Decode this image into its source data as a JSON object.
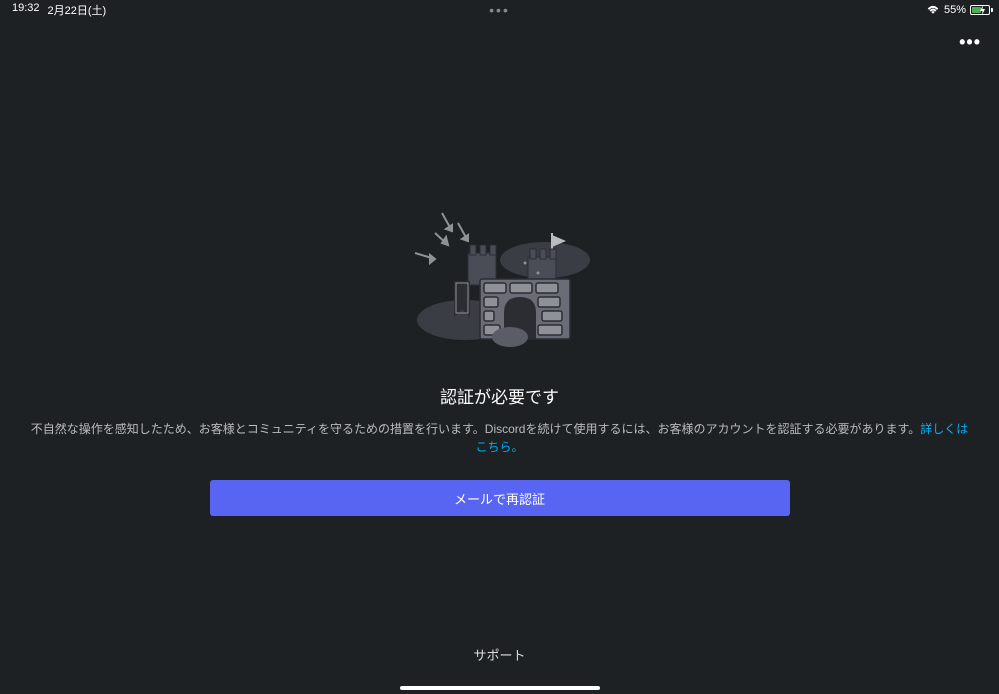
{
  "status_bar": {
    "time": "19:32",
    "date": "2月22日(土)",
    "center_dots": "•••",
    "battery_percent": "55%"
  },
  "app_bar": {
    "more_dots": "•••"
  },
  "main": {
    "title": "認証が必要です",
    "description_pre": "不自然な操作を感知したため、お客様とコミュニティを守るための措置を行います。Discordを続けて使用するには、お客様のアカウントを認証する必要があります。",
    "learn_more": "詳しくはこちら。",
    "verify_button": "メールで再認証",
    "support": "サポート"
  },
  "icons": {
    "wifi": "wifi-icon",
    "battery": "battery-icon",
    "charging": "charging-icon"
  }
}
